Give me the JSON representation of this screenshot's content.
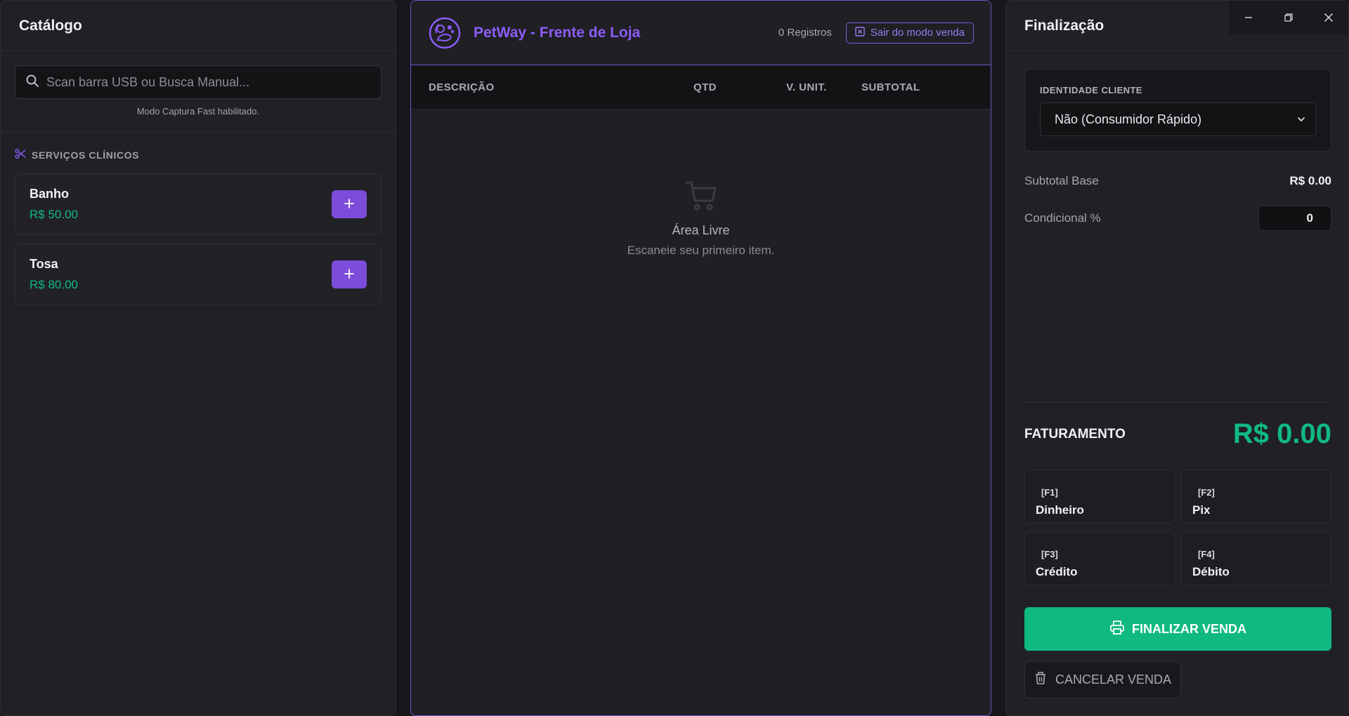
{
  "catalog": {
    "title": "Catálogo",
    "search": {
      "placeholder": "Scan barra USB ou Busca Manual...",
      "value": "",
      "hint": "Modo Captura Fast habilitado."
    },
    "section": {
      "label": "SERVIÇOS CLÍNICOS",
      "icon": "scissors-icon"
    },
    "items": [
      {
        "name": "Banho",
        "price": "R$ 50.00",
        "action_icon": "plus-icon"
      },
      {
        "name": "Tosa",
        "price": "R$ 80.00",
        "action_icon": "plus-icon"
      }
    ]
  },
  "register": {
    "title": "PetWay - Frente de Loja",
    "records": "0 Registros",
    "exit_label": "Sair do modo venda",
    "columns": [
      "DESCRIÇÃO",
      "QTD",
      "V. UNIT.",
      "SUBTOTAL"
    ],
    "empty_title": "Área Livre",
    "empty_subtitle": "Escaneie seu primeiro item."
  },
  "checkout": {
    "title": "Finalização",
    "client_label": "IDENTIDADE CLIENTE",
    "client_value": "Não (Consumidor Rápido)",
    "subtotal_label": "Subtotal Base",
    "subtotal_value": "R$ 0.00",
    "discount_label": "Condicional %",
    "discount_value": "0",
    "total_label": "FATURAMENTO",
    "total_value": "R$ 0.00",
    "payments": [
      {
        "key": "[F1]",
        "name": "Dinheiro"
      },
      {
        "key": "[F2]",
        "name": "Pix"
      },
      {
        "key": "[F3]",
        "name": "Crédito"
      },
      {
        "key": "[F4]",
        "name": "Débito"
      }
    ],
    "finalize_label": "FINALIZAR VENDA",
    "cancel_label": "CANCELAR VENDA"
  },
  "colors": {
    "accent": "#8b5cf6",
    "success": "#10b981",
    "background": "#17171b",
    "panel": "#202025"
  }
}
